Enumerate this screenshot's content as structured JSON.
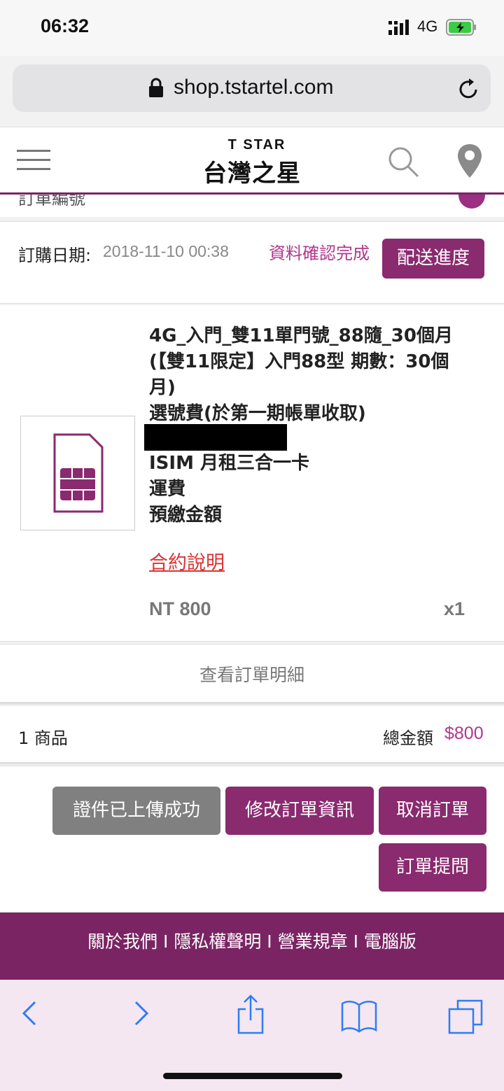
{
  "status_bar": {
    "time": "06:32",
    "network": "4G"
  },
  "browser": {
    "url": "shop.tstartel.com"
  },
  "site_header": {
    "brand_en": "T STAR",
    "brand_zh": "台灣之星"
  },
  "order": {
    "partial_row_text": "訂單編號",
    "date_label": "訂購日期:",
    "date_value": "2018-11-10 00:38",
    "status": "資料確認完成",
    "track_button": "配送進度"
  },
  "product": {
    "name": "4G_入門_雙11單門號_88隨_30個月 (【雙11限定】入門88型 期數：30個月)",
    "line_fee": "選號費(於第一期帳單收取)",
    "items": [
      "ISIM 月租三合一卡",
      "運費",
      "預繳金額"
    ],
    "contract_link": "合約說明",
    "price": "NT 800",
    "quantity": "x1"
  },
  "view_details": "查看訂單明細",
  "summary": {
    "count": "1 商品",
    "total_label": "總金額",
    "total_value": "$800"
  },
  "actions": {
    "uploaded": "證件已上傳成功",
    "edit": "修改訂單資訊",
    "cancel": "取消訂單",
    "ask": "訂單提問"
  },
  "footer": {
    "links": "關於我們 I 隱私權聲明 I 營業規章 I 電腦版"
  },
  "colors": {
    "brand_purple": "#8a2a6f",
    "status_pink": "#b2368c",
    "link_red": "#dd3333",
    "ios_blue": "#2e7cf6"
  },
  "toolbar_icons": [
    "back-icon",
    "forward-icon",
    "share-icon",
    "bookmarks-icon",
    "tabs-icon"
  ]
}
